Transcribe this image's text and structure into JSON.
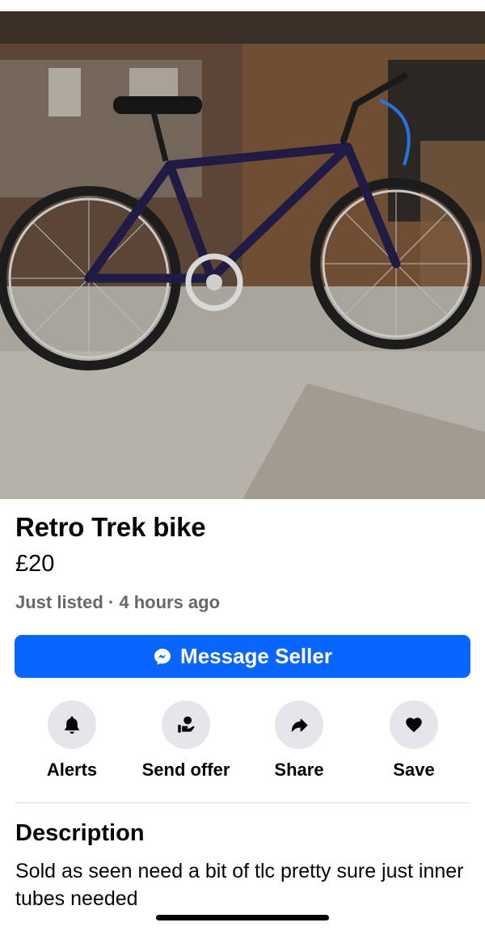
{
  "listing": {
    "title": "Retro Trek bike",
    "price": "£20",
    "listed_meta": "Just listed · 4 hours ago",
    "photo_icon": "bike-photo"
  },
  "primary_action": {
    "label": "Message Seller",
    "icon": "messenger-icon",
    "color": "#0866ff"
  },
  "actions": [
    {
      "label": "Alerts",
      "icon": "bell-icon"
    },
    {
      "label": "Send offer",
      "icon": "offer-icon"
    },
    {
      "label": "Share",
      "icon": "share-icon"
    },
    {
      "label": "Save",
      "icon": "heart-icon"
    }
  ],
  "description": {
    "heading": "Description",
    "body": "Sold as seen need a bit of tlc pretty sure just inner tubes needed"
  },
  "colors": {
    "accent": "#0866ff",
    "secondary_text": "#65676b",
    "icon_circle": "#e4e6eb"
  }
}
